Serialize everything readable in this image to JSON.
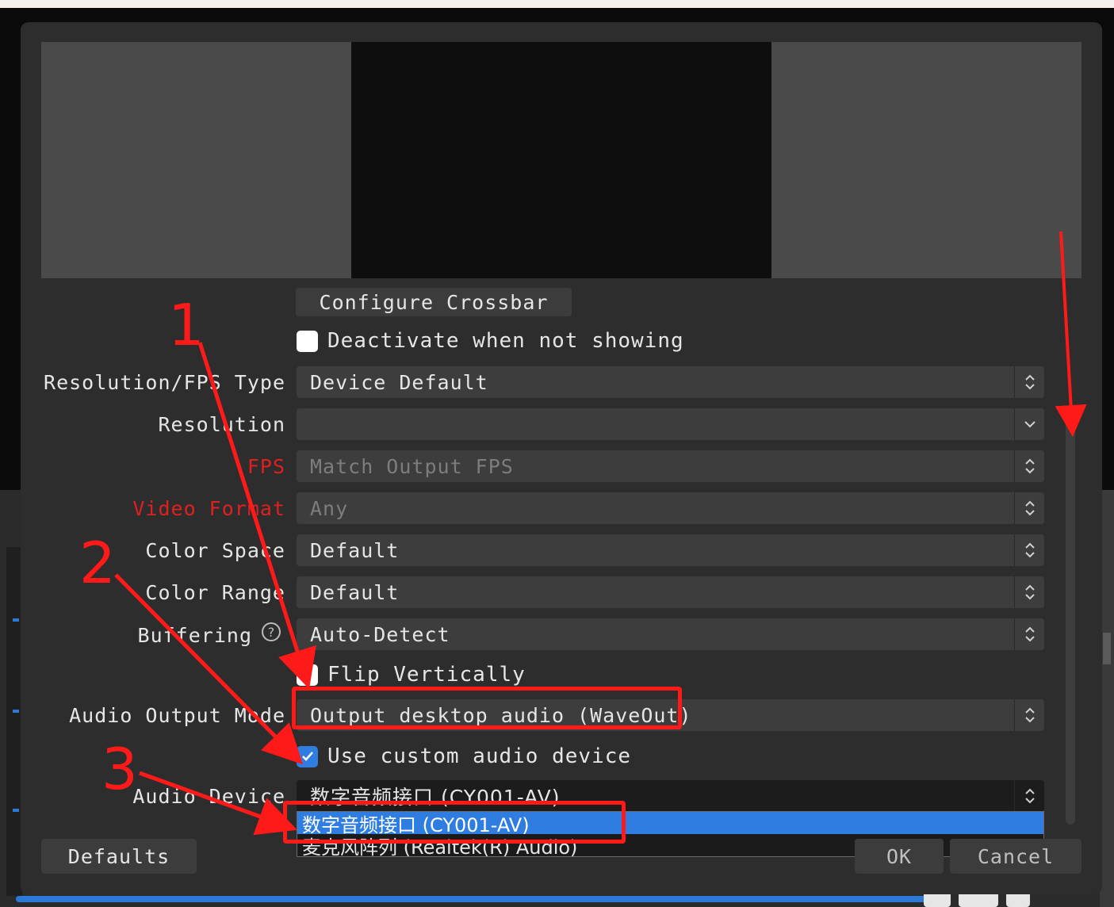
{
  "dialog": {
    "configure_crossbar_label": "Configure Crossbar",
    "deactivate_label": "Deactivate when not showing",
    "fields": [
      {
        "label": "Resolution/FPS Type",
        "value": "Device Default",
        "arrow": "updown",
        "label_warn": false,
        "disabled": false
      },
      {
        "label": "Resolution",
        "value": "",
        "arrow": "down",
        "label_warn": false,
        "disabled": false
      },
      {
        "label": "FPS",
        "value": "Match Output FPS",
        "arrow": "updown",
        "label_warn": true,
        "disabled": true
      },
      {
        "label": "Video Format",
        "value": "Any",
        "arrow": "updown",
        "label_warn": true,
        "disabled": true
      },
      {
        "label": "Color Space",
        "value": "Default",
        "arrow": "updown",
        "label_warn": false,
        "disabled": false
      },
      {
        "label": "Color Range",
        "value": "Default",
        "arrow": "updown",
        "label_warn": false,
        "disabled": false
      },
      {
        "label": "Buffering",
        "value": "Auto-Detect",
        "arrow": "updown",
        "label_warn": false,
        "disabled": false
      }
    ],
    "flip_vertically_label": "Flip Vertically",
    "audio_output_mode_label": "Audio Output Mode",
    "audio_output_mode_value": "Output desktop audio (WaveOut)",
    "use_custom_audio_label": "Use custom audio device",
    "audio_device_label": "Audio Device",
    "audio_device_value": "数字音频接口 (CY001-AV)",
    "audio_device_options": [
      "数字音频接口 (CY001-AV)",
      "麦克风阵列 (Realtek(R) Audio)"
    ],
    "defaults_label": "Defaults",
    "ok_label": "OK",
    "cancel_label": "Cancel"
  },
  "annotations": {
    "step1": "1",
    "step2": "2",
    "step3": "3",
    "color": "#ff1a1a"
  },
  "colors": {
    "dialog_bg": "#2d2d2d",
    "accent": "#2f7de1",
    "warning_label": "#e02020"
  },
  "icons": {
    "updown": "up-down-chevron-icon",
    "down": "chevron-down-icon",
    "check": "check-icon",
    "help": "help-icon"
  }
}
